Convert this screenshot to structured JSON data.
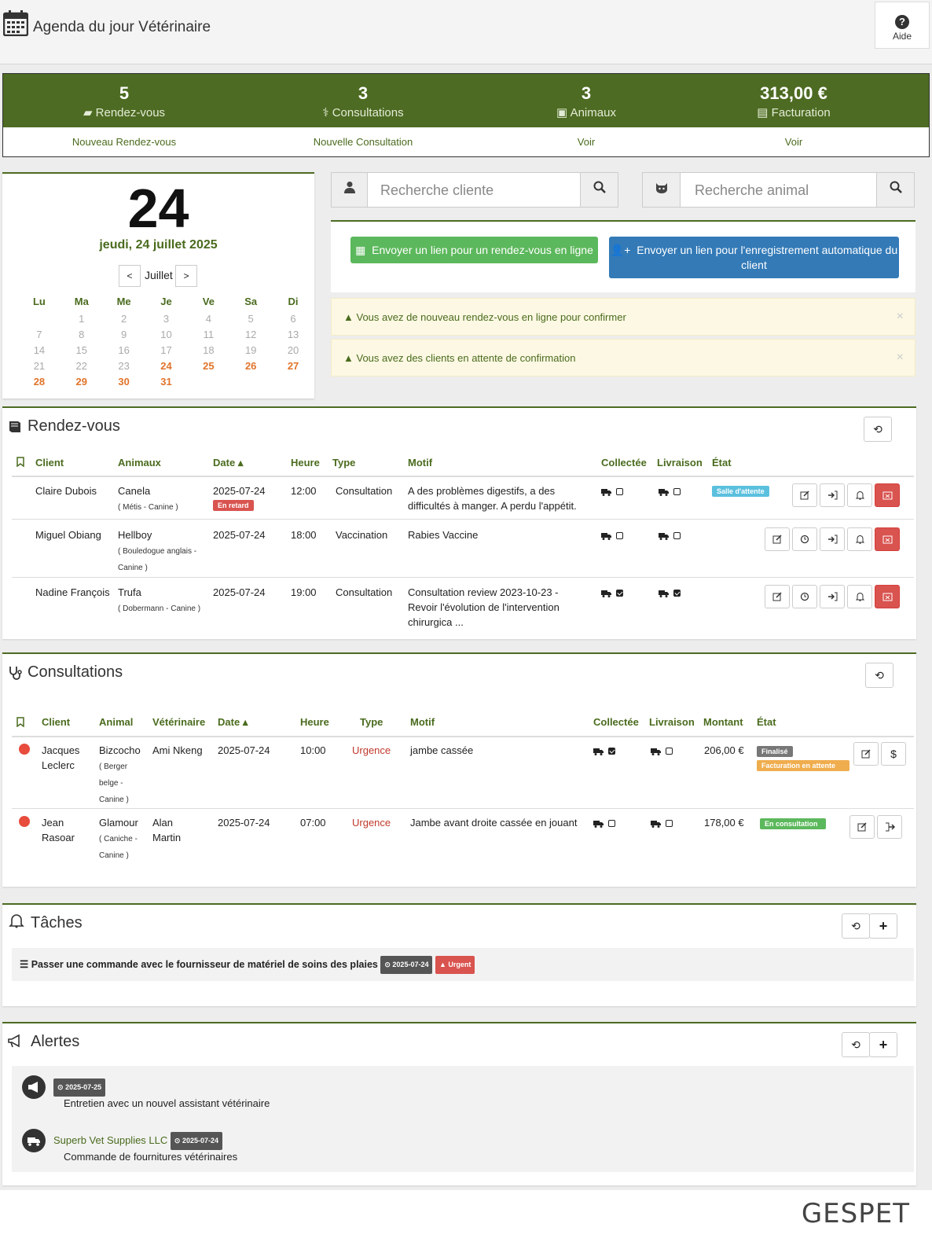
{
  "header": {
    "title": "Agenda du jour Vétérinaire",
    "help_label": "Aide"
  },
  "stats": [
    {
      "value": "5",
      "label": "Rendez-vous",
      "link": "Nouveau Rendez-vous"
    },
    {
      "value": "3",
      "label": "Consultations",
      "link": "Nouvelle Consultation"
    },
    {
      "value": "3",
      "label": "Animaux",
      "link": "Voir"
    },
    {
      "value": "313,00 €",
      "label": "Facturation",
      "link": "Voir"
    }
  ],
  "calendar": {
    "day": "24",
    "full_date": "jeudi, 24 juillet 2025",
    "month": "Juillet",
    "prev": "<",
    "next": ">",
    "weekdays": [
      "Lu",
      "Ma",
      "Me",
      "Je",
      "Ve",
      "Sa",
      "Di"
    ],
    "weeks": [
      [
        "",
        "1",
        "2",
        "3",
        "4",
        "5",
        "6"
      ],
      [
        "7",
        "8",
        "9",
        "10",
        "11",
        "12",
        "13"
      ],
      [
        "14",
        "15",
        "16",
        "17",
        "18",
        "19",
        "20"
      ],
      [
        "21",
        "22",
        "23",
        "24",
        "25",
        "26",
        "27"
      ],
      [
        "28",
        "29",
        "30",
        "31",
        "",
        "",
        ""
      ]
    ],
    "highlight_from": 24
  },
  "search": {
    "client_placeholder": "Recherche cliente",
    "animal_placeholder": "Recherche animal"
  },
  "actions": {
    "online_link": "Envoyer un lien pour un rendez-vous en ligne",
    "auto_register": "Envoyer un lien pour l'enregistrement automatique du client"
  },
  "alerts": [
    "Vous avez de nouveau rendez-vous en ligne pour confirmer",
    "Vous avez des clients en attente de confirmation"
  ],
  "appointments": {
    "title": "Rendez-vous",
    "columns": [
      "Client",
      "Animaux",
      "Date",
      "Heure",
      "Type",
      "Motif",
      "Collectée",
      "Livraison",
      "État"
    ],
    "rows": [
      {
        "client": "Claire Dubois",
        "animal": "Canela",
        "animal_sub": "( Métis - Canine )",
        "date": "2025-07-24",
        "late": "En retard",
        "time": "12:00",
        "type": "Consultation",
        "motif": "A des problèmes digestifs, a des difficultés à manger. A perdu l'appétit.",
        "collected": false,
        "delivery": false,
        "state": "Salle d'attente"
      },
      {
        "client": "Miguel Obiang",
        "animal": "Hellboy",
        "animal_sub": "( Bouledogue anglais - Canine )",
        "date": "2025-07-24",
        "late": "",
        "time": "18:00",
        "type": "Vaccination",
        "motif": "Rabies Vaccine",
        "collected": false,
        "delivery": false,
        "state": ""
      },
      {
        "client": "Nadine François",
        "animal": "Trufa",
        "animal_sub": "( Dobermann - Canine )",
        "date": "2025-07-24",
        "late": "",
        "time": "19:00",
        "type": "Consultation",
        "motif": "Consultation review 2023-10-23 - Revoir l'évolution de l'intervention chirurgica ...",
        "collected": true,
        "delivery": true,
        "state": ""
      }
    ]
  },
  "consultations": {
    "title": "Consultations",
    "columns": [
      "Client",
      "Animal",
      "Vétérinaire",
      "Date",
      "Heure",
      "Type",
      "Motif",
      "Collectée",
      "Livraison",
      "Montant",
      "État"
    ],
    "rows": [
      {
        "client": "Jacques Leclerc",
        "animal": "Bizcocho",
        "animal_sub": "( Berger belge - Canine )",
        "vet": "Ami Nkeng",
        "date": "2025-07-24",
        "time": "10:00",
        "type": "Urgence",
        "motif": "jambe cassée",
        "collected": true,
        "delivery": false,
        "amount": "206,00 €",
        "state": "Finalisé",
        "state2": "Facturation en attente"
      },
      {
        "client": "Jean Rasoar",
        "animal": "Glamour",
        "animal_sub": "( Caniche - Canine )",
        "vet": "Alan Martin",
        "date": "2025-07-24",
        "time": "07:00",
        "type": "Urgence",
        "motif": "Jambe avant droite cassée en jouant",
        "collected": false,
        "delivery": false,
        "amount": "178,00 €",
        "state": "En consultation",
        "state2": ""
      }
    ]
  },
  "tasks": {
    "title": "Tâches",
    "items": [
      {
        "text": "Passer une commande avec le fournisseur de matériel de soins des plaies",
        "date": "2025-07-24",
        "priority": "Urgent"
      }
    ]
  },
  "notices": {
    "title": "Alertes",
    "items": [
      {
        "source": "",
        "date": "2025-07-25",
        "text": "Entretien avec un nouvel assistant vétérinaire",
        "icon": "megaphone-icon"
      },
      {
        "source": "Superb Vet Supplies LLC",
        "date": "2025-07-24",
        "text": "Commande de fournitures vétérinaires",
        "icon": "truck-icon"
      }
    ]
  },
  "brand": "GESPET",
  "colors": {
    "brand_green": "#4d6b22",
    "highlight_orange": "#e0742b",
    "danger": "#d9534f",
    "info": "#5bc0de",
    "success": "#5cb85c",
    "primary": "#337ab7",
    "warning": "#f0ad4e"
  }
}
